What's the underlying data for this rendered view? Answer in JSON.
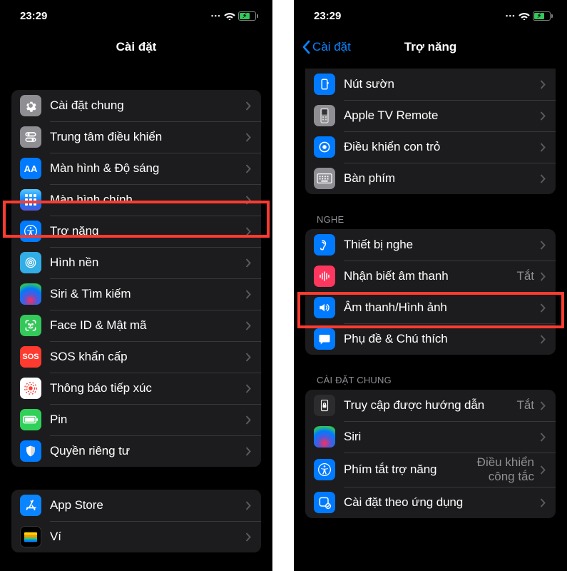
{
  "status": {
    "time": "23:29"
  },
  "left": {
    "title": "Cài đặt",
    "items": {
      "general": "Cài đặt chung",
      "control": "Trung tâm điều khiển",
      "display": "Màn hình & Độ sáng",
      "home": "Màn hình chính",
      "accessibility": "Trợ năng",
      "wallpaper": "Hình nền",
      "siri": "Siri & Tìm kiếm",
      "faceid": "Face ID & Mật mã",
      "sos": "SOS khẩn cấp",
      "exposure": "Thông báo tiếp xúc",
      "battery": "Pin",
      "privacy": "Quyền riêng tư",
      "appstore": "App Store",
      "wallet": "Ví"
    }
  },
  "right": {
    "back": "Cài đặt",
    "title": "Trợ năng",
    "items": {
      "sidebutton": "Nút sườn",
      "tvremote": "Apple TV Remote",
      "pointer": "Điều khiển con trỏ",
      "keyboard": "Bàn phím",
      "group_hearing": "Nghe",
      "hearing": "Thiết bị nghe",
      "soundrec": "Nhận biết âm thanh",
      "soundrec_val": "Tắt",
      "audiovisual": "Âm thanh/Hình ảnh",
      "subtitles": "Phụ đề & Chú thích",
      "group_general": "Cài đặt chung",
      "guided": "Truy cập được hướng dẫn",
      "guided_val": "Tắt",
      "siri": "Siri",
      "shortcut": "Phím tắt trợ năng",
      "shortcut_val": "Điều khiển công tắc",
      "perapp": "Cài đặt theo ứng dụng"
    }
  }
}
